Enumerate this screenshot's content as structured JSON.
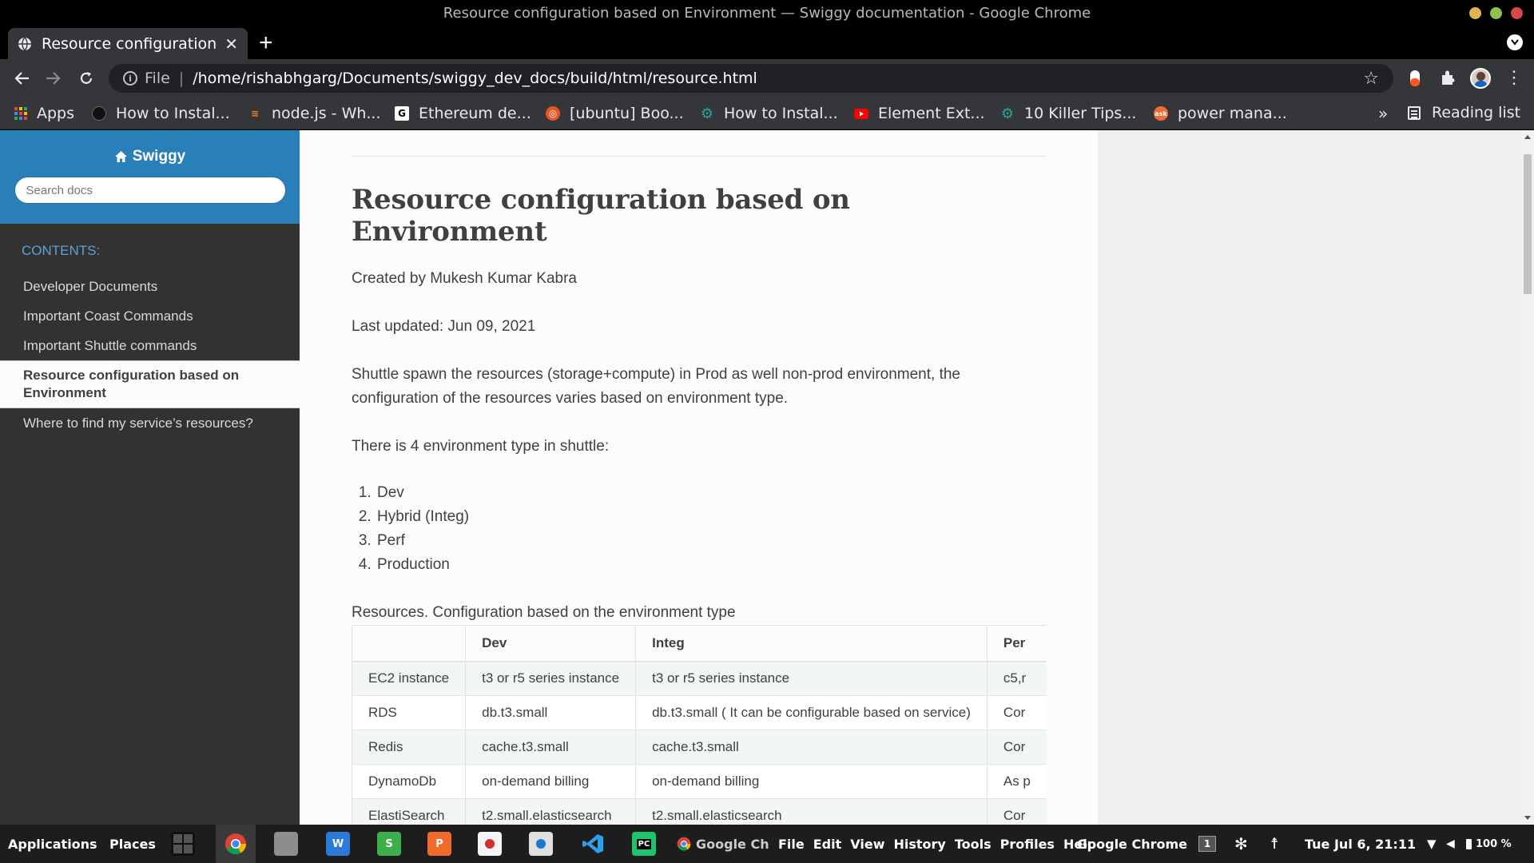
{
  "window": {
    "title": "Resource configuration based on Environment — Swiggy documentation - Google Chrome"
  },
  "browser": {
    "tab": {
      "title": "Resource configuration based on Environment"
    },
    "address": {
      "scheme_label": "File",
      "url": "/home/rishabhgarg/Documents/swiggy_dev_docs/build/html/resource.html"
    },
    "bookmarks": {
      "apps_label": "Apps",
      "items": [
        {
          "label": "How to Instal...",
          "icon": "github-icon",
          "color": "#111111"
        },
        {
          "label": "node.js - Wh...",
          "icon": "stackoverflow-icon",
          "color": "#f48024"
        },
        {
          "label": "Ethereum de...",
          "icon": "google-icon",
          "color": "#ffffff"
        },
        {
          "label": "[ubuntu] Boo...",
          "icon": "ubuntu-icon",
          "color": "#e95420"
        },
        {
          "label": "How to Instal...",
          "icon": "gear-icon",
          "color": "#26a69a"
        },
        {
          "label": "Element Ext...",
          "icon": "youtube-icon",
          "color": "#ff0000"
        },
        {
          "label": "10 Killer Tips...",
          "icon": "gear-icon",
          "color": "#26a69a"
        },
        {
          "label": "power mana...",
          "icon": "askubuntu-icon",
          "color": "#ef6c33"
        }
      ],
      "more_label": "»",
      "reading_list_label": "Reading list"
    }
  },
  "sidebar": {
    "brand": "Swiggy",
    "search_placeholder": "Search docs",
    "caption": "CONTENTS:",
    "items": [
      {
        "label": "Developer Documents"
      },
      {
        "label": "Important Coast Commands"
      },
      {
        "label": "Important Shuttle commands"
      },
      {
        "label": "Resource configuration based on Environment"
      },
      {
        "label": "Where to find my service’s resources?"
      }
    ]
  },
  "page": {
    "title": "Resource configuration based on Environment",
    "created_by": "Created by Mukesh Kumar Kabra",
    "last_updated": "Last updated: Jun 09, 2021",
    "intro": "Shuttle spawn the resources (storage+compute) in Prod as well non-prod environment, the configuration of the resources varies based on environment type.",
    "env_count": "There is 4 environment type in shuttle:",
    "env_types": [
      "Dev",
      "Hybrid (Integ)",
      "Perf",
      "Production"
    ],
    "table_caption": "Resources. Configuration based on the environment type",
    "table": {
      "headers": [
        "",
        "Dev",
        "Integ",
        "Per"
      ],
      "rows": [
        [
          "EC2 instance",
          "t3 or r5 series instance",
          "t3 or r5 series instance",
          "c5,r"
        ],
        [
          "RDS",
          "db.t3.small",
          "db.t3.small ( It can be configurable based on service)",
          "Cor"
        ],
        [
          "Redis",
          "cache.t3.small",
          "cache.t3.small",
          "Cor"
        ],
        [
          "DynamoDb",
          "on-demand billing",
          "on-demand billing",
          "As p"
        ],
        [
          "ElastiSearch",
          "t2.small.elasticsearch",
          "t2.small.elasticsearch",
          "Cor"
        ]
      ]
    }
  },
  "taskbar": {
    "applications_label": "Applications",
    "places_label": "Places",
    "chrome_window_label": "Google Ch",
    "menu": [
      "File",
      "Edit",
      "View",
      "History",
      "Tools",
      "Profiles",
      "Help"
    ],
    "app_name": "Google Chrome",
    "workspace": "1",
    "clock": "Tue Jul  6, 21:11",
    "battery": "100 %"
  },
  "colors": {
    "accent": "#2980b9",
    "sidebar_bg": "#343131",
    "caption": "#55a5d9",
    "link_current_bg": "#fcfcfc"
  }
}
